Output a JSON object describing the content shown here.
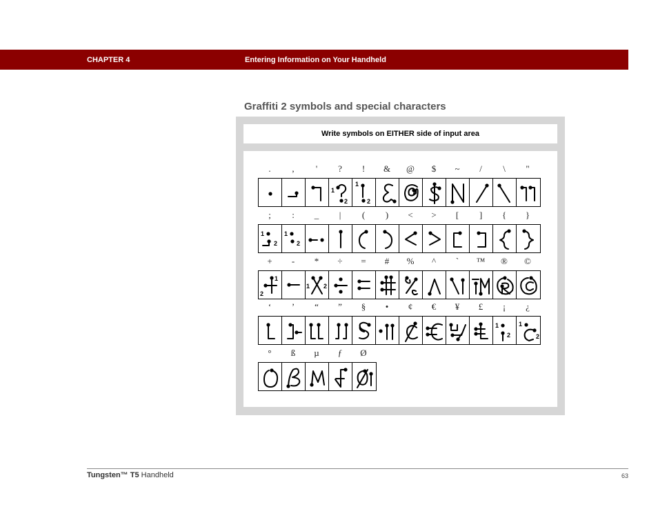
{
  "header": {
    "chapter": "CHAPTER 4",
    "title": "Entering Information on Your Handheld",
    "bar_color": "#8b0000"
  },
  "section": {
    "title": "Graffiti 2 symbols and special characters"
  },
  "panel": {
    "banner": "Write symbols on EITHER side of input area",
    "rows": [
      {
        "symbols": [
          ".",
          ",",
          "'",
          "?",
          "!",
          "&",
          "@",
          "$",
          "~",
          "/",
          "\\",
          "\""
        ],
        "strokes": [
          "dot",
          "comma",
          "apostrophe",
          "question",
          "exclaim",
          "ampersand",
          "at",
          "dollar",
          "tilde",
          "slash",
          "backslash",
          "quote"
        ]
      },
      {
        "symbols": [
          ";",
          ":",
          "_",
          "|",
          "(",
          ")",
          "<",
          ">",
          "[",
          "]",
          "{",
          "}"
        ],
        "strokes": [
          "semicolon",
          "colon",
          "underscore",
          "pipe",
          "lparen",
          "rparen",
          "less",
          "greater",
          "lbracket",
          "rbracket",
          "lbrace",
          "rbrace"
        ]
      },
      {
        "symbols": [
          "+",
          "-",
          "*",
          "÷",
          "=",
          "#",
          "%",
          "^",
          "`",
          "™",
          "®",
          "©"
        ],
        "strokes": [
          "plus",
          "minus",
          "asterisk",
          "divide",
          "equals",
          "hash",
          "percent",
          "caret",
          "backtick",
          "trademark",
          "registered",
          "copyright"
        ]
      },
      {
        "symbols": [
          "‘",
          "’",
          "“",
          "”",
          "§",
          "•",
          "¢",
          "€",
          "¥",
          "£",
          "¡",
          "¿"
        ],
        "strokes": [
          "lsquo",
          "rsquo",
          "ldquo",
          "rdquo",
          "section",
          "bullet",
          "cent",
          "euro",
          "yen",
          "pound",
          "invexclaim",
          "invquestion"
        ]
      },
      {
        "symbols": [
          "°",
          "ß",
          "µ",
          "ƒ",
          "Ø"
        ],
        "strokes": [
          "degree",
          "eszett",
          "micro",
          "florin",
          "oslash"
        ]
      }
    ]
  },
  "footer": {
    "product_prefix": "Tungsten™",
    "product_model": "T5",
    "product_suffix": "Handheld",
    "page_number": "63"
  }
}
